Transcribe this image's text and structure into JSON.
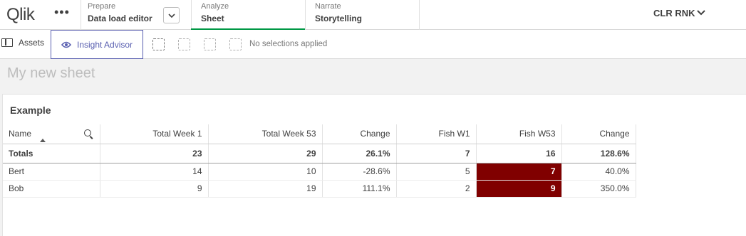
{
  "app": {
    "logo_text": "Qlik",
    "menu_glyph": "•••"
  },
  "nav": {
    "prepare": {
      "caption": "Prepare",
      "label": "Data load editor"
    },
    "analyze": {
      "caption": "Analyze",
      "label": "Sheet"
    },
    "narrate": {
      "caption": "Narrate",
      "label": "Storytelling"
    },
    "dropdown_glyph": "⌄"
  },
  "user": {
    "name": "CLR RNK",
    "chevron": "⌄"
  },
  "toolbar": {
    "assets_label": "Assets",
    "insight_label": "Insight Advisor",
    "selections_text": "No selections applied"
  },
  "sheet": {
    "title": "My new sheet"
  },
  "table": {
    "title": "Example",
    "columns": [
      "Name",
      "Total Week 1",
      "Total Week 53",
      "Change",
      "Fish W1",
      "Fish W53",
      "Change"
    ],
    "totals": [
      "Totals",
      "23",
      "29",
      "26.1%",
      "7",
      "16",
      "128.6%"
    ],
    "rows": [
      [
        "Bert",
        "14",
        "10",
        "-28.6%",
        "5",
        "7",
        "40.0%"
      ],
      [
        "Bob",
        "9",
        "19",
        "111.1%",
        "2",
        "9",
        "350.0%"
      ]
    ]
  },
  "colors": {
    "highlight": "#800000",
    "accent": "#595fb0",
    "active_tab": "#009845"
  }
}
